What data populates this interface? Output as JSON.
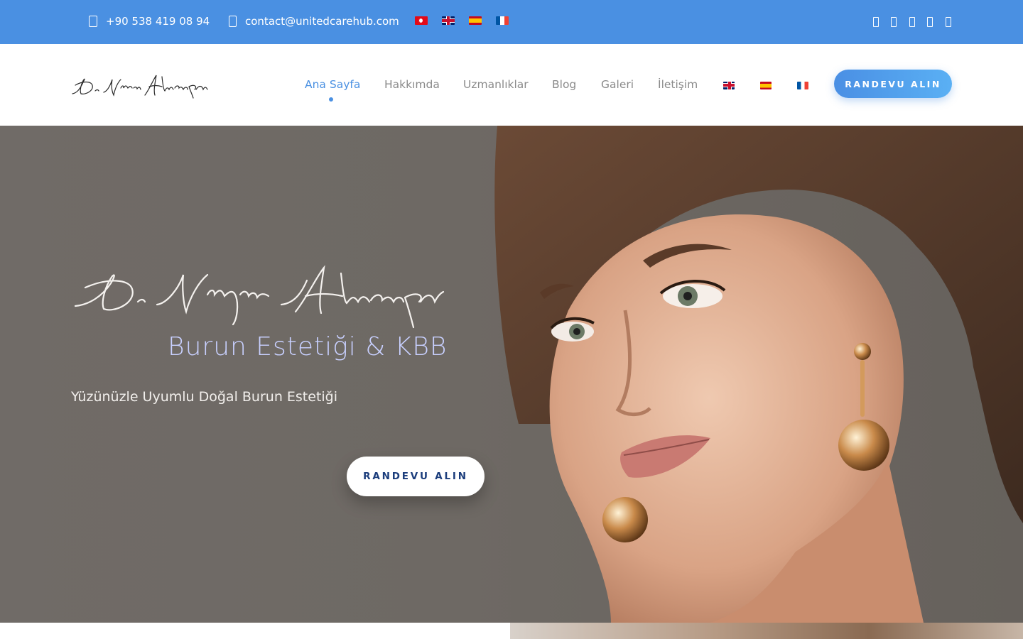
{
  "topbar": {
    "phone": "+90 538 419 08 94",
    "email": "contact@unitedcarehub.com",
    "flags": [
      "tr-flag",
      "gb-flag",
      "es-flag",
      "fr-flag"
    ],
    "social_icons": [
      "facebook-icon",
      "twitter-icon",
      "instagram-icon",
      "youtube-icon",
      "linkedin-icon"
    ]
  },
  "header": {
    "nav": [
      "Ana Sayfa",
      "Hakkımda",
      "Uzmanlıklar",
      "Blog",
      "Galeri",
      "İletişim"
    ],
    "active_nav": "Ana Sayfa",
    "cta": "RANDEVU ALIN"
  },
  "hero": {
    "subtitle": "Burun Estetiği & KBB",
    "tagline": "Yüzünüzle Uyumlu Doğal Burun Estetiği",
    "cta": "RANDEVU ALIN"
  },
  "colors": {
    "accent": "#4a90e2",
    "nav_text": "#8a8a8a",
    "hero_subtitle": "#c8d0ff",
    "hero_button_text": "#1b3d7c"
  }
}
